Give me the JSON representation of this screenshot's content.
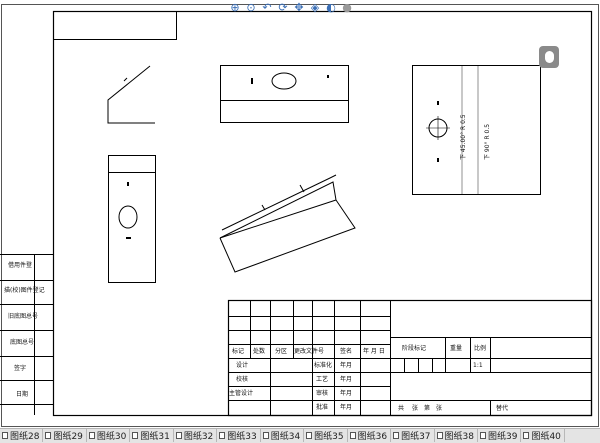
{
  "toolbar": {
    "icons": [
      "zoom-fit-icon",
      "zoom-area-icon",
      "previous-view-icon",
      "rotate-icon",
      "pan-icon",
      "view-orientation-icon",
      "display-style-icon",
      "hide-show-icon"
    ]
  },
  "side_labels": [
    "借用件登",
    "描(校)图件登记",
    "旧底图总号",
    "底图总号",
    "签字",
    "日期"
  ],
  "title_block": {
    "header": [
      "标记",
      "处数",
      "分区",
      "更改文件号",
      "签名",
      "年 月 日"
    ],
    "rows": [
      "设计",
      "校核",
      "主管设计"
    ],
    "mid": [
      "标准化",
      "工艺",
      "审核",
      "批准"
    ],
    "dates": [
      "年月",
      "年月",
      "年月",
      "年月"
    ],
    "right_header": [
      "阶段标记",
      "重量",
      "比例"
    ],
    "scale": "1:1",
    "bottom": [
      "共",
      "张",
      "第",
      "张"
    ],
    "replace": "替代"
  },
  "view_notes": [
    "下 45.00° R 0.5",
    "下 90° R 0.5"
  ],
  "tabs": [
    "图纸28",
    "图纸29",
    "图纸30",
    "图纸31",
    "图纸32",
    "图纸33",
    "图纸34",
    "图纸35",
    "图纸36",
    "图纸37",
    "图纸38",
    "图纸39",
    "图纸40"
  ]
}
